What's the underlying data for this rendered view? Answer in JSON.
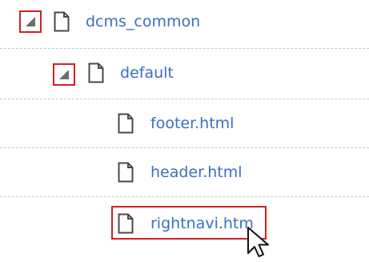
{
  "tree": {
    "nodes": [
      {
        "label": "dcms_common",
        "icon": "file-icon",
        "expanded": true,
        "toggle_icon": "collapse-triangle-icon"
      },
      {
        "label": "default",
        "icon": "file-icon",
        "expanded": true,
        "toggle_icon": "collapse-triangle-icon"
      },
      {
        "label": "footer.html",
        "icon": "file-icon"
      },
      {
        "label": "header.html",
        "icon": "file-icon"
      },
      {
        "label": "rightnavi.htm",
        "icon": "file-icon",
        "highlighted": true
      }
    ]
  },
  "pointer": {
    "icon": "mouse-pointer-icon"
  },
  "colors": {
    "link": "#3a6fc4",
    "highlight": "#d42020",
    "triangle": "#6e6e6e",
    "divider": "#c8c8c8"
  }
}
